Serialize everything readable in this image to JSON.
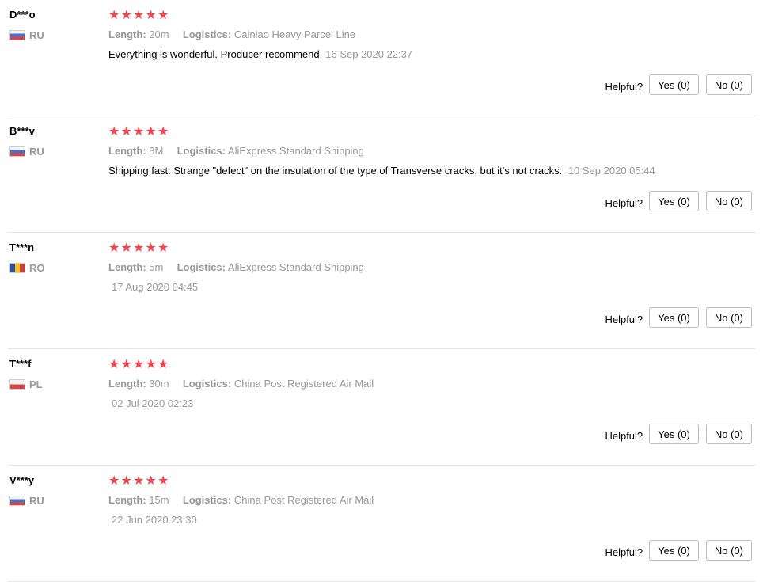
{
  "labels": {
    "length": "Length:",
    "logistics": "Logistics:",
    "helpful": "Helpful?"
  },
  "star_icon": "star-icon",
  "star_color": "#f0474f",
  "reviews": [
    {
      "user": "D***o",
      "country": "RU",
      "flag": "flag-ru",
      "rating": 5,
      "length": "20m",
      "logistics": "Cainiao Heavy Parcel Line",
      "text": "Everything is wonderful. Producer recommend",
      "date": "16 Sep 2020 22:37",
      "yes": "Yes (0)",
      "no": "No (0)"
    },
    {
      "user": "B***v",
      "country": "RU",
      "flag": "flag-ru",
      "rating": 5,
      "length": "8M",
      "logistics": "AliExpress Standard Shipping",
      "text": "Shipping fast. Strange \"defect\" on the insulation of the type of Transverse cracks, but it's not cracks.",
      "date": "10 Sep 2020 05:44",
      "yes": "Yes (0)",
      "no": "No (0)"
    },
    {
      "user": "T***n",
      "country": "RO",
      "flag": "flag-ro",
      "rating": 5,
      "length": "5m",
      "logistics": "AliExpress Standard Shipping",
      "text": "",
      "date": "17 Aug 2020 04:45",
      "yes": "Yes (0)",
      "no": "No (0)"
    },
    {
      "user": "T***f",
      "country": "PL",
      "flag": "flag-pl",
      "rating": 5,
      "length": "30m",
      "logistics": "China Post Registered Air Mail",
      "text": "",
      "date": "02 Jul 2020 02:23",
      "yes": "Yes (0)",
      "no": "No (0)"
    },
    {
      "user": "V***y",
      "country": "RU",
      "flag": "flag-ru",
      "rating": 5,
      "length": "15m",
      "logistics": "China Post Registered Air Mail",
      "text": "",
      "date": "22 Jun 2020 23:30",
      "yes": "Yes (0)",
      "no": "No (0)"
    }
  ]
}
